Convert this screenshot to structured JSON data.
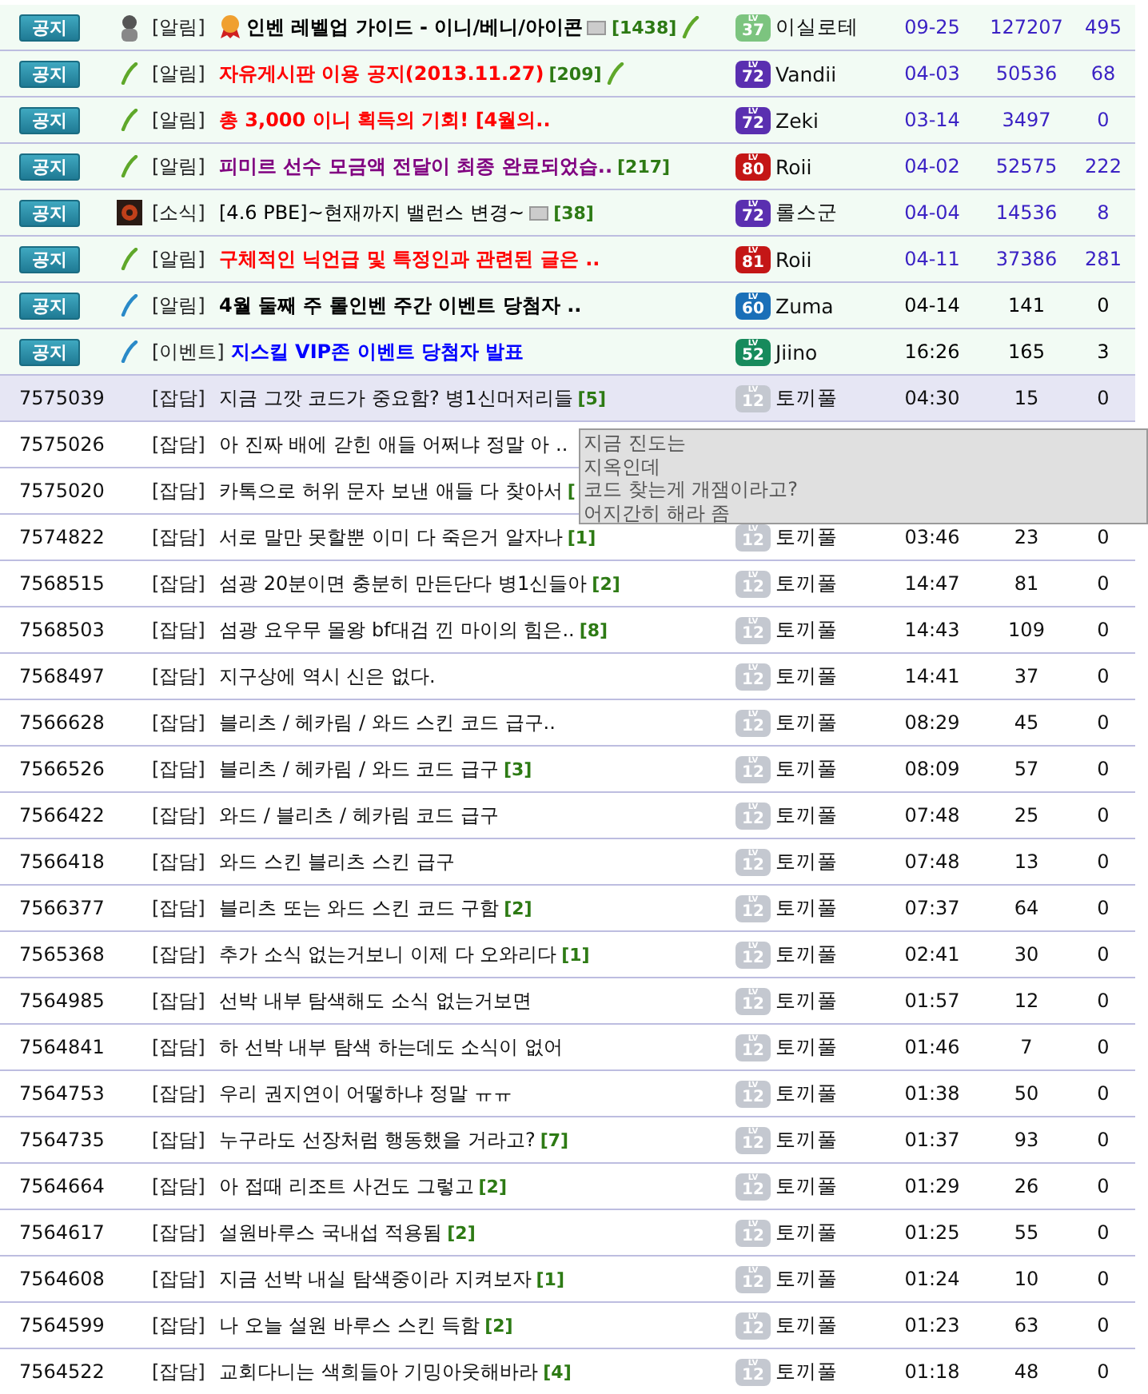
{
  "notices": [
    {
      "badge": "공지",
      "kind": "figure",
      "category": "[알림]",
      "medal": true,
      "title": "인벤 레벨업 가이드 - 이니/베니/아이콘",
      "color": "#000000",
      "bold": true,
      "image_icon": true,
      "comments": "[1438]",
      "pen_icon": true,
      "rank": {
        "lv": "LV",
        "label": "37",
        "color": "#7cc47f"
      },
      "author": "이실로테",
      "date": "09-25",
      "views": "127207",
      "recs": "495",
      "highlighted": true
    },
    {
      "badge": "공지",
      "kind": "pen-green",
      "category": "[알림]",
      "medal": false,
      "title": "자유게시판 이용 공지(2013.11.27)",
      "color": "#ff0000",
      "bold": true,
      "image_icon": false,
      "comments": "[209]",
      "pen_icon": true,
      "rank": {
        "lv": "LV",
        "label": "72",
        "color": "#5a2fb0"
      },
      "author": "Vandii",
      "date": "04-03",
      "views": "50536",
      "recs": "68",
      "highlighted": true
    },
    {
      "badge": "공지",
      "kind": "pen-green",
      "category": "[알림]",
      "medal": false,
      "title": "총 3,000 이니 획득의 기회! [4월의..",
      "color": "#ff0000",
      "bold": true,
      "image_icon": false,
      "pen_icon": false,
      "rank": {
        "lv": "LV",
        "label": "72",
        "color": "#5a2fb0"
      },
      "author": "Zeki",
      "date": "03-14",
      "views": "3497",
      "recs": "0",
      "highlighted": true
    },
    {
      "badge": "공지",
      "kind": "pen-green",
      "category": "[알림]",
      "medal": false,
      "title": "피미르 선수 모금액 전달이 최종 완료되었습..",
      "color": "#800080",
      "bold": true,
      "image_icon": false,
      "comments": "[217]",
      "pen_icon": false,
      "rank": {
        "lv": "LV",
        "label": "80",
        "color": "#c41616"
      },
      "author": "Roii",
      "date": "04-02",
      "views": "52575",
      "recs": "222",
      "highlighted": true
    },
    {
      "badge": "공지",
      "kind": "orb",
      "category": "[소식]",
      "medal": false,
      "title": "[4.6 PBE]~현재까지 밸런스 변경~",
      "color": "#000000",
      "bold": false,
      "image_icon": true,
      "comments": "[38]",
      "pen_icon": false,
      "rank": {
        "lv": "LV",
        "label": "72",
        "color": "#5a2fb0"
      },
      "author": "롤스군",
      "date": "04-04",
      "views": "14536",
      "recs": "8",
      "highlighted": true
    },
    {
      "badge": "공지",
      "kind": "pen-green",
      "category": "[알림]",
      "medal": false,
      "title": "구체적인 닉언급 및 특정인과 관련된 글은 ..",
      "color": "#ff0000",
      "bold": true,
      "image_icon": false,
      "pen_icon": false,
      "rank": {
        "lv": "LV",
        "label": "81",
        "color": "#c41616"
      },
      "author": "Roii",
      "date": "04-11",
      "views": "37386",
      "recs": "281",
      "highlighted": true
    },
    {
      "badge": "공지",
      "kind": "pen-blue",
      "category": "[알림]",
      "medal": false,
      "title": "4월 둘째 주 롤인벤 주간 이벤트 당첨자 ..",
      "color": "#000000",
      "bold": true,
      "image_icon": false,
      "pen_icon": false,
      "rank": {
        "lv": "LV",
        "label": "60",
        "color": "#1a6fb8"
      },
      "author": "Zuma",
      "date": "04-14",
      "views": "141",
      "recs": "0",
      "highlighted": false
    },
    {
      "badge": "공지",
      "kind": "pen-blue",
      "category": "[이벤트]",
      "medal": false,
      "title": "지스킬 VIP존 이벤트 당첨자 발표",
      "color": "#0000ff",
      "bold": true,
      "image_icon": false,
      "pen_icon": false,
      "rank": {
        "lv": "LV",
        "label": "52",
        "color": "#178a5c"
      },
      "author": "Jiino",
      "date": "16:26",
      "views": "165",
      "recs": "3",
      "highlighted": false
    }
  ],
  "posts": [
    {
      "id": "7575039",
      "category": "[잡담]",
      "title": "지금 그깟 코드가 중요함? 병1신머저리들",
      "comments": "[5]",
      "lv": "LV",
      "rank": "12",
      "author": "토끼풀",
      "date": "04:30",
      "views": "15",
      "recs": "0",
      "selected": true
    },
    {
      "id": "7575026",
      "category": "[잡담]",
      "title": "아 진짜 배에 갇힌 애들 어쩌냐 정말 아 ..",
      "selected": false
    },
    {
      "id": "7575020",
      "category": "[잡담]",
      "title": "카톡으로 허위 문자 보낸 애들 다 찾아서",
      "comments": "[",
      "selected": false
    },
    {
      "id": "7574822",
      "category": "[잡담]",
      "title": "서로 말만 못할뿐 이미 다 죽은거 알자나",
      "comments": "[1]",
      "lv": "LV",
      "rank": "12",
      "author": "토끼풀",
      "date": "03:46",
      "views": "23",
      "recs": "0",
      "selected": false
    },
    {
      "id": "7568515",
      "category": "[잡담]",
      "title": "섬광 20분이면 충분히 만든단다 병1신들아",
      "comments": "[2]",
      "lv": "LV",
      "rank": "12",
      "author": "토끼풀",
      "date": "14:47",
      "views": "81",
      "recs": "0",
      "selected": false
    },
    {
      "id": "7568503",
      "category": "[잡담]",
      "title": "섬광 요우무 몰왕 bf대검 낀 마이의 힘은..",
      "comments": "[8]",
      "lv": "LV",
      "rank": "12",
      "author": "토끼풀",
      "date": "14:43",
      "views": "109",
      "recs": "0",
      "selected": false
    },
    {
      "id": "7568497",
      "category": "[잡담]",
      "title": "지구상에 역시 신은 없다.",
      "lv": "LV",
      "rank": "12",
      "author": "토끼풀",
      "date": "14:41",
      "views": "37",
      "recs": "0",
      "selected": false
    },
    {
      "id": "7566628",
      "category": "[잡담]",
      "title": "블리츠 / 헤카림 / 와드 스킨 코드 급구..",
      "lv": "LV",
      "rank": "12",
      "author": "토끼풀",
      "date": "08:29",
      "views": "45",
      "recs": "0",
      "selected": false
    },
    {
      "id": "7566526",
      "category": "[잡담]",
      "title": "블리츠 / 헤카림 / 와드 코드 급구",
      "comments": "[3]",
      "lv": "LV",
      "rank": "12",
      "author": "토끼풀",
      "date": "08:09",
      "views": "57",
      "recs": "0",
      "selected": false
    },
    {
      "id": "7566422",
      "category": "[잡담]",
      "title": "와드 / 블리츠 / 헤카림 코드 급구",
      "lv": "LV",
      "rank": "12",
      "author": "토끼풀",
      "date": "07:48",
      "views": "25",
      "recs": "0",
      "selected": false
    },
    {
      "id": "7566418",
      "category": "[잡담]",
      "title": "와드 스킨 블리츠 스킨 급구",
      "lv": "LV",
      "rank": "12",
      "author": "토끼풀",
      "date": "07:48",
      "views": "13",
      "recs": "0",
      "selected": false
    },
    {
      "id": "7566377",
      "category": "[잡담]",
      "title": "블리츠 또는 와드 스킨 코드 구함",
      "comments": "[2]",
      "lv": "LV",
      "rank": "12",
      "author": "토끼풀",
      "date": "07:37",
      "views": "64",
      "recs": "0",
      "selected": false
    },
    {
      "id": "7565368",
      "category": "[잡담]",
      "title": "추가 소식 없는거보니 이제 다 오와리다",
      "comments": "[1]",
      "lv": "LV",
      "rank": "12",
      "author": "토끼풀",
      "date": "02:41",
      "views": "30",
      "recs": "0",
      "selected": false
    },
    {
      "id": "7564985",
      "category": "[잡담]",
      "title": "선박 내부 탐색해도 소식 없는거보면",
      "lv": "LV",
      "rank": "12",
      "author": "토끼풀",
      "date": "01:57",
      "views": "12",
      "recs": "0",
      "selected": false
    },
    {
      "id": "7564841",
      "category": "[잡담]",
      "title": "하 선박 내부 탐색 하는데도 소식이 없어",
      "lv": "LV",
      "rank": "12",
      "author": "토끼풀",
      "date": "01:46",
      "views": "7",
      "recs": "0",
      "selected": false
    },
    {
      "id": "7564753",
      "category": "[잡담]",
      "title": "우리 권지연이 어떻하냐 정말 ㅠㅠ",
      "lv": "LV",
      "rank": "12",
      "author": "토끼풀",
      "date": "01:38",
      "views": "50",
      "recs": "0",
      "selected": false
    },
    {
      "id": "7564735",
      "category": "[잡담]",
      "title": "누구라도 선장처럼 행동했을 거라고?",
      "comments": "[7]",
      "lv": "LV",
      "rank": "12",
      "author": "토끼풀",
      "date": "01:37",
      "views": "93",
      "recs": "0",
      "selected": false
    },
    {
      "id": "7564664",
      "category": "[잡담]",
      "title": "아 접때 리조트 사건도 그렇고",
      "comments": "[2]",
      "lv": "LV",
      "rank": "12",
      "author": "토끼풀",
      "date": "01:29",
      "views": "26",
      "recs": "0",
      "selected": false
    },
    {
      "id": "7564617",
      "category": "[잡담]",
      "title": "설원바루스 국내섭 적용됨",
      "comments": "[2]",
      "lv": "LV",
      "rank": "12",
      "author": "토끼풀",
      "date": "01:25",
      "views": "55",
      "recs": "0",
      "selected": false
    },
    {
      "id": "7564608",
      "category": "[잡담]",
      "title": "지금 선박 내실 탐색중이라 지켜보자",
      "comments": "[1]",
      "lv": "LV",
      "rank": "12",
      "author": "토끼풀",
      "date": "01:24",
      "views": "10",
      "recs": "0",
      "selected": false
    },
    {
      "id": "7564599",
      "category": "[잡담]",
      "title": "나 오늘 설원 바루스 스킨 득함",
      "comments": "[2]",
      "lv": "LV",
      "rank": "12",
      "author": "토끼풀",
      "date": "01:23",
      "views": "63",
      "recs": "0",
      "selected": false
    },
    {
      "id": "7564522",
      "category": "[잡담]",
      "title": "교회다니는 색희들아 기밍아웃해바라",
      "comments": "[4]",
      "lv": "LV",
      "rank": "12",
      "author": "토끼풀",
      "date": "01:18",
      "views": "48",
      "recs": "0",
      "selected": false
    }
  ],
  "tooltip": {
    "lines": [
      "지금 진도는",
      "지옥인데",
      "코드 찾는게 개잼이라고?",
      "어지간히 해라 좀"
    ]
  }
}
